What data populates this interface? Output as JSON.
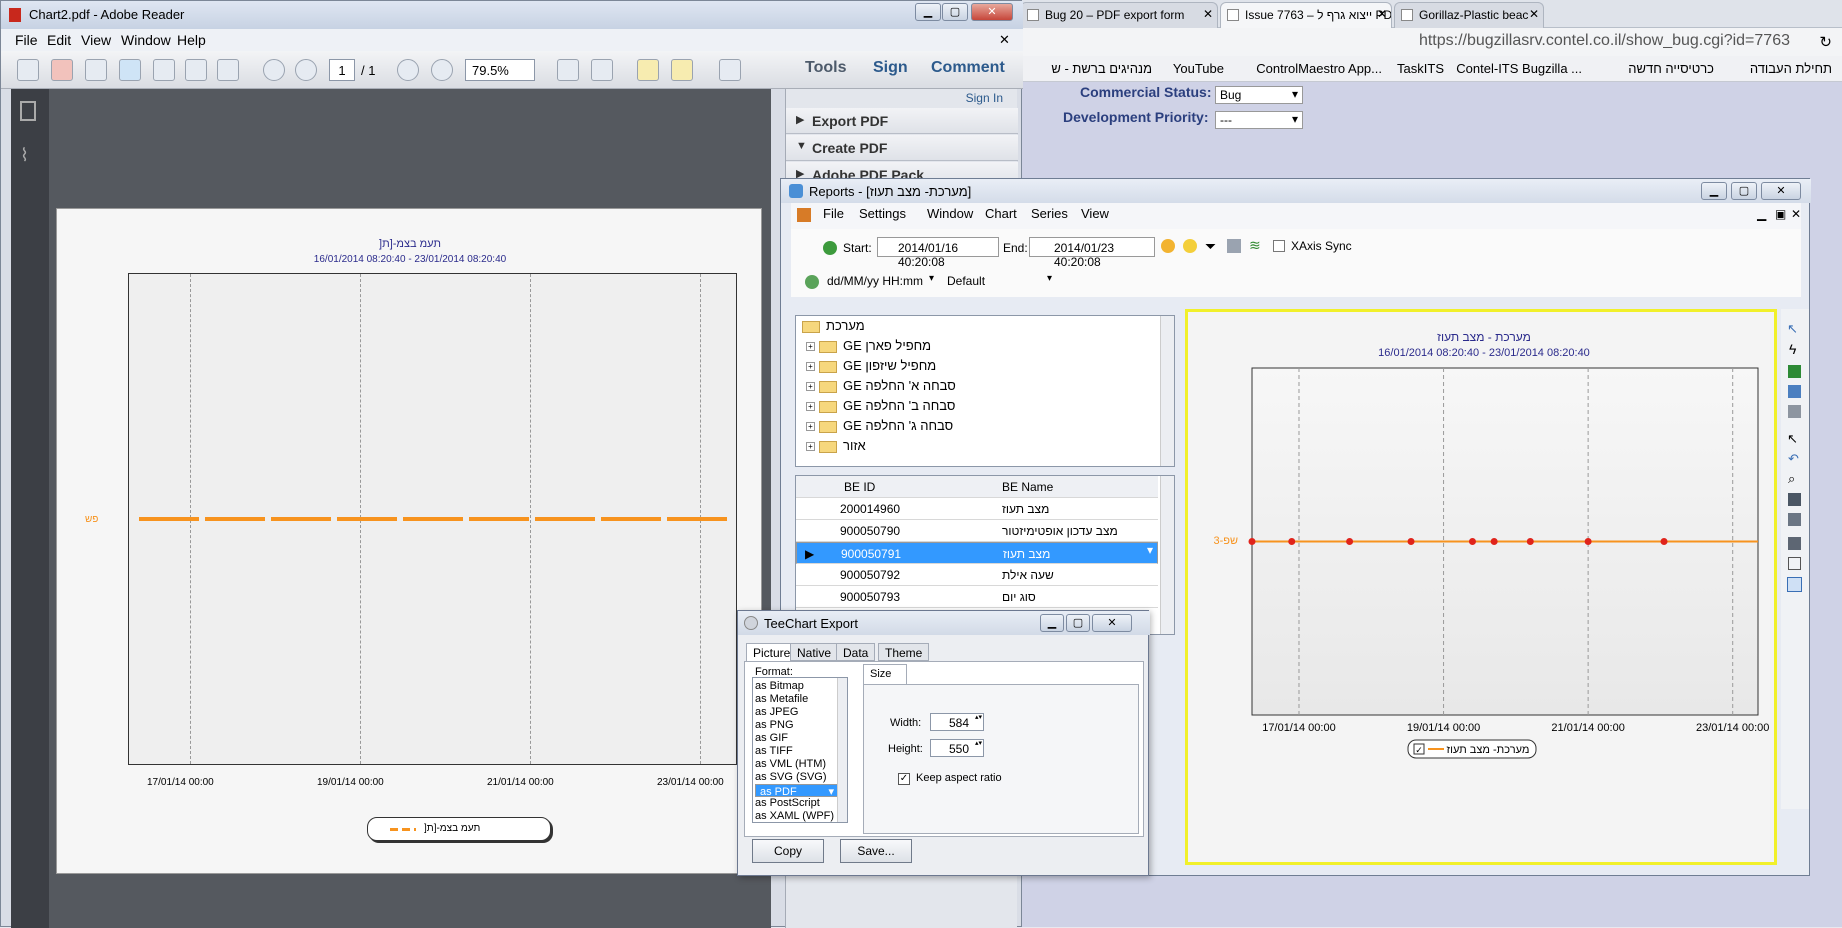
{
  "browser": {
    "tabs": [
      {
        "label": "Bug 20 – PDF export form"
      },
      {
        "label": "Issue 7763 – ייצוא גרף ל PDF"
      },
      {
        "label": "Gorillaz-Plastic beac"
      }
    ],
    "url": "https://bugzillasrv.contel.co.il/show_bug.cgi?id=7763",
    "bookmarks": [
      "תחילת העבודה",
      "כרטיסייה חדשה",
      "Contel-ITS Bugzilla ...",
      "TaskITS",
      "ControlMaestro App...",
      "YouTube",
      "מנהיגים ברשת - ש"
    ],
    "fields": [
      {
        "label": "Commercial Status:",
        "value": "Bug"
      },
      {
        "label": "Development Priority:",
        "value": "---"
      }
    ]
  },
  "reader": {
    "title": "Chart2.pdf - Adobe Reader",
    "menu": [
      "File",
      "Edit",
      "View",
      "Window",
      "Help"
    ],
    "page_current": "1",
    "page_total": "/ 1",
    "zoom": "79.5%",
    "tools_label": "Tools",
    "sign_label": "Sign",
    "comment_label": "Comment",
    "sign_in": "Sign In",
    "panes": [
      "Export PDF",
      "Create PDF",
      "Adobe PDF Pack"
    ]
  },
  "pdf_chart": {
    "title": "]תעמ בצמ-[ת",
    "subtitle": "16/01/2014 08:20:40 - 23/01/2014 08:20:40",
    "y_label": "פש",
    "x_ticks": [
      "17/01/14 00:00",
      "19/01/14 00:00",
      "21/01/14 00:00",
      "23/01/14 00:00"
    ],
    "legend": "]תעמ בצמ-[ת"
  },
  "reports": {
    "title": "Reports - [מערכת- מצב תעוז]",
    "menu": [
      "File",
      "Settings",
      "Window",
      "Chart",
      "Series",
      "View"
    ],
    "start_label": "Start:",
    "start_value": "2014/01/16 40:20:08",
    "end_label": "End:",
    "end_value": "2014/01/23 40:20:08",
    "xaxis_sync": "XAxis Sync",
    "date_format": "dd/MM/yy HH:mm",
    "theme": "Default",
    "tree_root": "מערכת",
    "tree_items": [
      "GE מחפיל פארן",
      "GE מחפיל שיזפון",
      "GE סבחה א' החלפה",
      "GE סבחה ב' החלפה",
      "GE סבחה ג' החלפה",
      "אזור"
    ],
    "grid_headers": [
      "BE ID",
      "BE Name"
    ],
    "grid_rows": [
      {
        "id": "200014960",
        "name": "מצב תעוז"
      },
      {
        "id": "900050790",
        "name": "מצב עדכון אופטימיזטור"
      },
      {
        "id": "900050791",
        "name": "מצב תעוז"
      },
      {
        "id": "900050792",
        "name": "שעה אילת"
      },
      {
        "id": "900050793",
        "name": "סוג יום"
      }
    ]
  },
  "chart_data": {
    "type": "line",
    "title": "מערכת - מצב תעוז",
    "subtitle": "16/01/2014 08:20:40 - 23/01/2014 08:20:40",
    "y_label": "3-שפ",
    "x_ticks": [
      "17/01/14 00:00",
      "19/01/14 00:00",
      "21/01/14 00:00",
      "23/01/14 00:00"
    ],
    "xlim": [
      0,
      7
    ],
    "series": [
      {
        "name": "מערכת- מצב תעוז",
        "color": "#f7931e",
        "x": [
          0,
          0.55,
          1.35,
          2.2,
          3.05,
          3.35,
          3.85,
          4.65,
          5.7
        ],
        "values": [
          1,
          1,
          1,
          1,
          1,
          1,
          1,
          1,
          1
        ]
      }
    ],
    "legend": "מערכת- מצב תעוז"
  },
  "export": {
    "title": "TeeChart Export",
    "tabs": [
      "Picture",
      "Native",
      "Data",
      "Theme"
    ],
    "format_label": "Format:",
    "size_tab": "Size",
    "formats": [
      "as Bitmap",
      "as Metafile",
      "as JPEG",
      "as PNG",
      "as GIF",
      "as TIFF",
      "as VML (HTM)",
      "as SVG (SVG)",
      "as PDF",
      "as PostScript",
      "as XAML (WPF)"
    ],
    "selected_format": "as PDF",
    "width_label": "Width:",
    "width_value": "584",
    "height_label": "Height:",
    "height_value": "550",
    "keep_aspect": "Keep aspect ratio",
    "copy_label": "Copy",
    "save_label": "Save..."
  }
}
